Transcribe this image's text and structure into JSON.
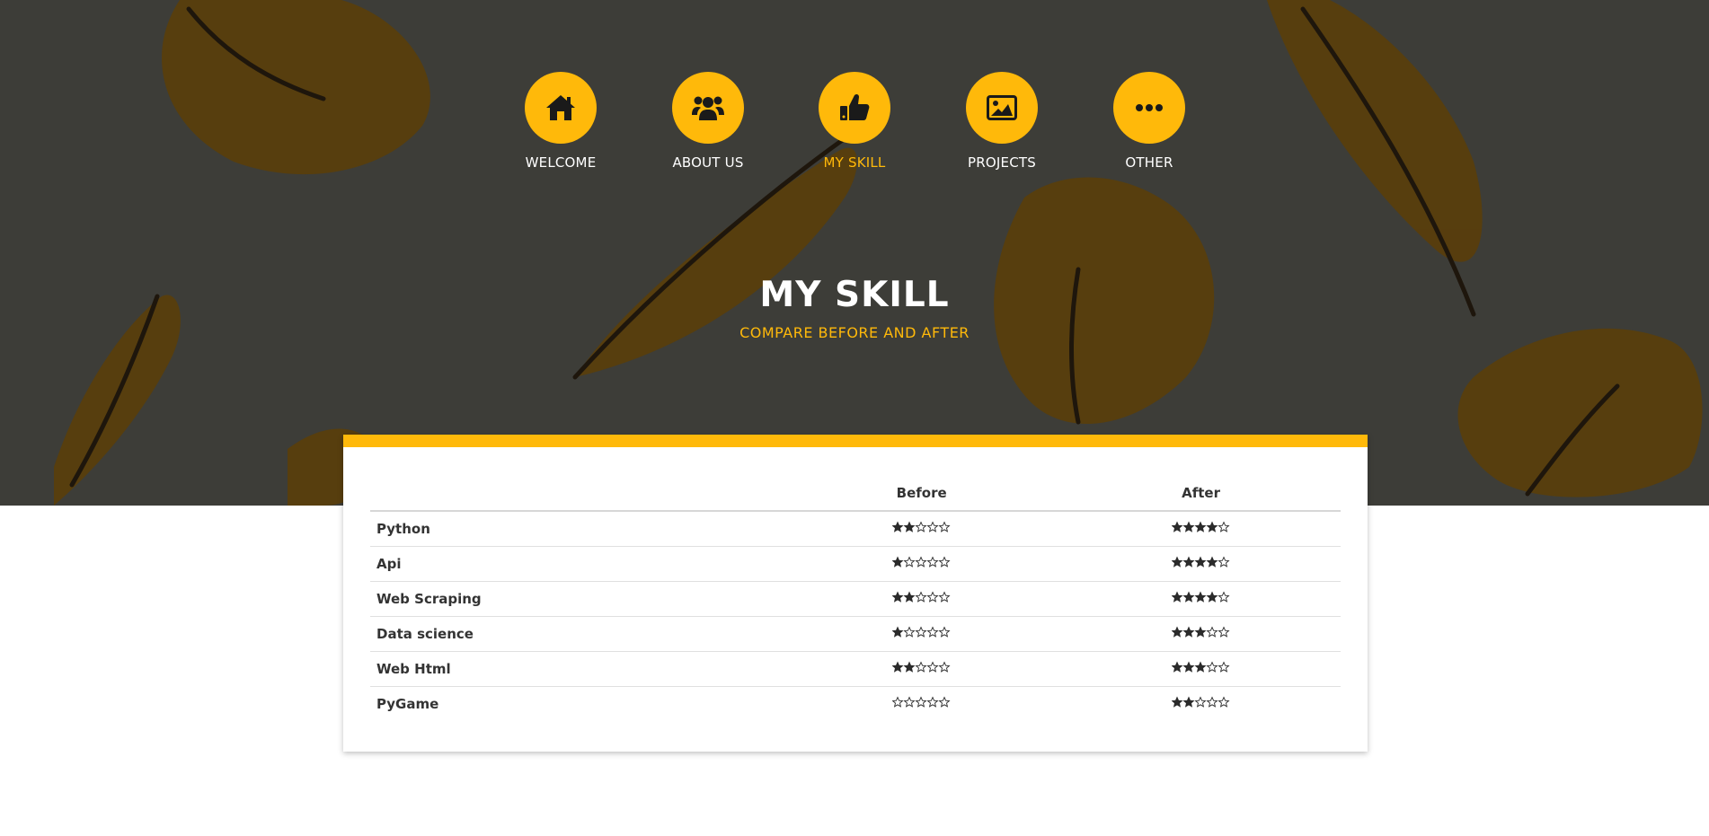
{
  "colors": {
    "accent": "#ffb90a",
    "hero_bg": "#3d3d38",
    "text_dark": "#333333"
  },
  "nav": {
    "items": [
      {
        "label": "WELCOME",
        "icon": "home-icon",
        "active": false
      },
      {
        "label": "ABOUT US",
        "icon": "users-icon",
        "active": false
      },
      {
        "label": "MY SKILL",
        "icon": "thumbs-up-icon",
        "active": true
      },
      {
        "label": "PROJECTS",
        "icon": "image-icon",
        "active": false
      },
      {
        "label": "OTHER",
        "icon": "more-icon",
        "active": false
      }
    ]
  },
  "hero": {
    "title": "MY SKILL",
    "subtitle": "COMPARE BEFORE AND AFTER"
  },
  "table": {
    "headers": [
      "",
      "Before",
      "After"
    ],
    "max_stars": 5,
    "rows": [
      {
        "skill": "Python",
        "before": 2,
        "after": 4
      },
      {
        "skill": "Api",
        "before": 1,
        "after": 4
      },
      {
        "skill": "Web Scraping",
        "before": 2,
        "after": 4
      },
      {
        "skill": "Data science",
        "before": 1,
        "after": 3
      },
      {
        "skill": "Web Html",
        "before": 2,
        "after": 3
      },
      {
        "skill": "PyGame",
        "before": 0,
        "after": 2
      }
    ]
  }
}
